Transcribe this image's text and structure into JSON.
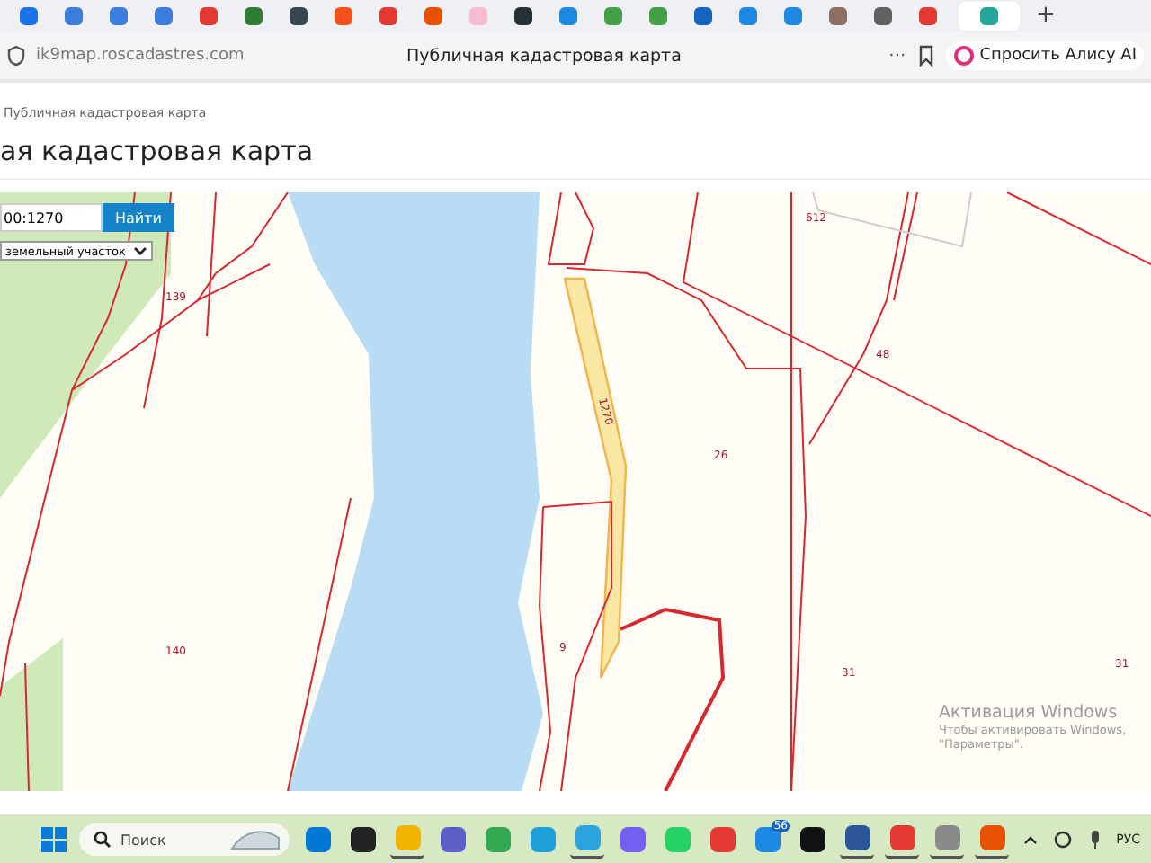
{
  "browser": {
    "tabs": [
      {
        "color": "#1a73e8",
        "selected": false
      },
      {
        "color": "#3b7ddd",
        "selected": false
      },
      {
        "color": "#3b7ddd",
        "selected": false
      },
      {
        "color": "#3b7ddd",
        "selected": false
      },
      {
        "color": "#e53935",
        "selected": false
      },
      {
        "color": "#2e7d32",
        "selected": false
      },
      {
        "color": "#37474f",
        "selected": false
      },
      {
        "color": "#f4511e",
        "selected": false
      },
      {
        "color": "#e53935",
        "selected": false
      },
      {
        "color": "#e65100",
        "selected": false
      },
      {
        "color": "#f8bbd0",
        "selected": false
      },
      {
        "color": "#263238",
        "selected": false
      },
      {
        "color": "#1e88e5",
        "selected": false
      },
      {
        "color": "#43a047",
        "selected": false
      },
      {
        "color": "#43a047",
        "selected": false
      },
      {
        "color": "#1565c0",
        "selected": false
      },
      {
        "color": "#1e88e5",
        "selected": false
      },
      {
        "color": "#1e88e5",
        "selected": false
      },
      {
        "color": "#8d6e63",
        "selected": false
      },
      {
        "color": "#616161",
        "selected": false
      },
      {
        "color": "#e53935",
        "selected": false
      },
      {
        "color": "#26a69a",
        "selected": true
      }
    ],
    "new_tab": "+",
    "address": "ik9map.roscadastres.com",
    "page_title": "Публичная кадастровая карта",
    "menu": "···",
    "assistant_button": "Спросить Алису AI"
  },
  "page": {
    "breadcrumb": "Публичная кадастровая карта",
    "heading": "ая кадастровая карта",
    "search": {
      "value": "00:1270",
      "button": "Найти"
    },
    "object_type": {
      "value": "земельный участок"
    },
    "map": {
      "labels": [
        "139",
        "140",
        "9",
        "1270",
        "26",
        "48",
        "612",
        "31",
        "31"
      ]
    }
  },
  "activation": {
    "title": "Активация Windows",
    "text": "Чтобы активировать Windows,",
    "link": "\"Параметры\"."
  },
  "taskbar": {
    "search": {
      "placeholder": "Поиск"
    },
    "apps": [
      {
        "color": "#0078d4",
        "selected": false
      },
      {
        "color": "#222222",
        "selected": false
      },
      {
        "color": "#f2b400",
        "selected": true
      },
      {
        "color": "#5b5fc7",
        "selected": false
      },
      {
        "color": "#34a853",
        "selected": false
      },
      {
        "color": "#1fa0d8",
        "selected": false
      },
      {
        "color": "#2aa3df",
        "selected": true
      },
      {
        "color": "#7360f2",
        "selected": false
      },
      {
        "color": "#25d366",
        "selected": false
      },
      {
        "color": "#e53935",
        "selected": false
      },
      {
        "color": "#1e88e5",
        "selected": false,
        "badge": "56"
      },
      {
        "color": "#111111",
        "selected": false
      },
      {
        "color": "#2b579a",
        "selected": true
      },
      {
        "color": "#e53935",
        "selected": true
      },
      {
        "color": "#8a8a8a",
        "selected": true
      },
      {
        "color": "#e65100",
        "selected": true
      }
    ],
    "language": "РУС"
  }
}
